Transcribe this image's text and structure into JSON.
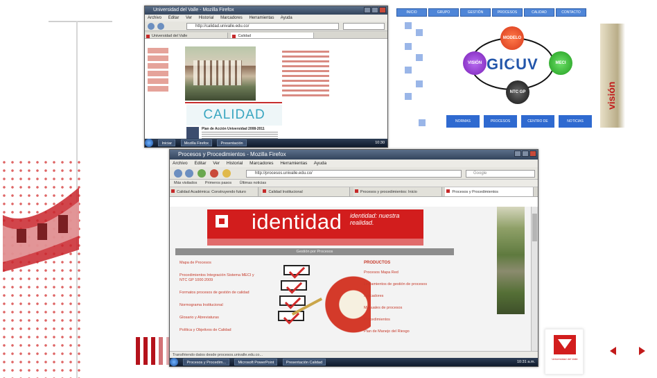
{
  "colors": {
    "accent": "#d21d1d",
    "dark_red": "#b5121b",
    "title_blue": "#39a6c0",
    "gicuv_blue": "#2255aa"
  },
  "window1": {
    "title": "Universidad del Valle - Mozilla Firefox",
    "menu": [
      "Archivo",
      "Editar",
      "Ver",
      "Historial",
      "Marcadores",
      "Herramientas",
      "Ayuda"
    ],
    "url": "http://calidad.univalle.edu.co/",
    "tabs": [
      "Universidad del Valle",
      "Calidad"
    ],
    "calidad": "CALIDAD",
    "footer_title": "Plan de Acción Universidad 2008-2011",
    "taskbar": [
      "Iniciar",
      "Mozilla Firefox",
      "Presentación"
    ],
    "clock": "10:30"
  },
  "gicuv": {
    "title": "GICUV",
    "top_tabs": [
      "INICIO",
      "GRUPO",
      "GESTIÓN",
      "PROCESOS",
      "CALIDAD",
      "CONTACTO"
    ],
    "circles": {
      "top": "MODELO DE GESTIÓN",
      "left": "VISIÓN",
      "right": "MECI",
      "bottom": "NTC GP 1000"
    },
    "bottom_buttons": [
      "NORMAS",
      "PROCESOS",
      "CENTRO DE CALIDAD",
      "NOTICIAS"
    ],
    "vision": "visión"
  },
  "window2": {
    "title": "Procesos y Procedimientos - Mozilla Firefox",
    "menu": [
      "Archivo",
      "Editar",
      "Ver",
      "Historial",
      "Marcadores",
      "Herramientas",
      "Ayuda"
    ],
    "url": "http://procesos.univalle.edu.co/",
    "search_placeholder": "Google",
    "bookmarks": [
      "Más visitados",
      "Primeros pasos",
      "Últimas noticias"
    ],
    "tabs": [
      "Calidad Académica: Construyendo futuro",
      "Calidad Institucional",
      "Procesos y procedimientos: Inicio",
      "Procesos y Procedimientos"
    ],
    "banner_title": "identidad",
    "banner_sub": "identidad: nuestra realidad.",
    "section_title": "Gestión por Procesos",
    "left_links": [
      "Mapa de Procesos",
      "Procedimientos Integración Sistema MECI y NTC GP 1000:2009",
      "Formatos procesos de gestión de calidad",
      "Normograma Institucional",
      "Glosario y Abreviaturas",
      "Política y Objetivos de Calidad"
    ],
    "right_head": "PRODUCTOS",
    "right_links": [
      "Procesos Mapa Red",
      "Lineamientos de gestión de procesos",
      "Indicadores",
      "Manuales de procesos",
      "Procedimientos",
      "Plan de Manejo del Riesgo"
    ],
    "status": "Transfiriendo datos desde procesos.univalle.edu.co...",
    "taskbar": [
      "Procesos y Procedim...",
      "Microsoft PowerPoint",
      "Presentación Calidad"
    ],
    "clock": "10:31 a.m."
  },
  "brand": {
    "university": "Universidad del Valle"
  }
}
